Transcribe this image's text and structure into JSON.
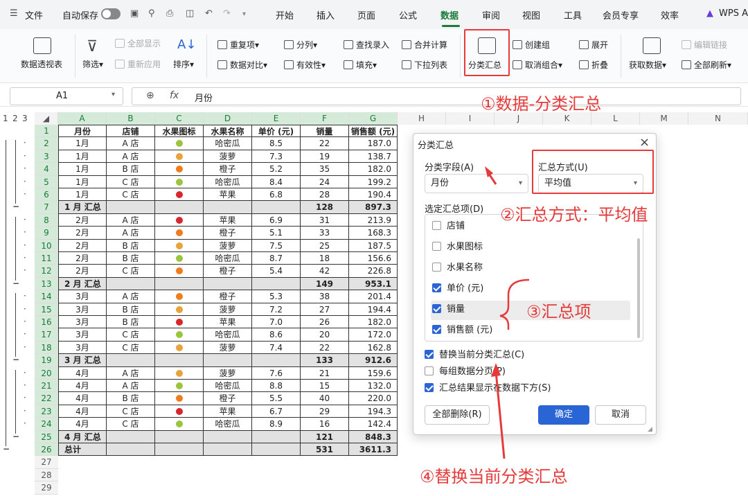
{
  "menubar": {
    "file": "文件",
    "autosave": "自动保存",
    "tabs": [
      "开始",
      "插入",
      "页面",
      "公式",
      "数据",
      "审阅",
      "视图",
      "工具",
      "会员专享",
      "效率"
    ],
    "active": "数据",
    "wps": "WPS A"
  },
  "ribbon": {
    "pivot": "数据透视表",
    "filter": "筛选",
    "show_all": "全部显示",
    "reapply": "重新应用",
    "sort": "排序",
    "duplicates": "重复项",
    "compare": "数据对比",
    "split": "分列",
    "validity": "有效性",
    "lookup": "查找录入",
    "fill": "填充",
    "merge_calc": "合并计算",
    "dropdown": "下拉列表",
    "subtotal": "分类汇总",
    "create_group": "创建组",
    "ungroup": "取消组合",
    "expand": "展开",
    "collapse": "折叠",
    "get_data": "获取数据",
    "edit_links": "编辑链接",
    "refresh_all": "全部刷新"
  },
  "formula_bar": {
    "cell_ref": "A1",
    "fx": "fx",
    "content": "月份"
  },
  "grid": {
    "col_letters": [
      "A",
      "B",
      "C",
      "D",
      "E",
      "F",
      "G",
      "H",
      "I",
      "J",
      "K",
      "L",
      "M",
      "N"
    ],
    "levels": [
      "1",
      "2",
      "3"
    ],
    "headers": [
      "月份",
      "店铺",
      "水果图标",
      "水果名称",
      "单价 (元)",
      "销量",
      "销售额 (元)"
    ],
    "rows": [
      {
        "n": "2",
        "m": "1月",
        "s": "A 店",
        "f": "pear",
        "name": "哈密瓜",
        "p": "8.5",
        "q": "22",
        "a": "187.0"
      },
      {
        "n": "3",
        "m": "1月",
        "s": "A 店",
        "f": "pineapple",
        "name": "菠萝",
        "p": "7.3",
        "q": "19",
        "a": "138.7"
      },
      {
        "n": "4",
        "m": "1月",
        "s": "B 店",
        "f": "orange",
        "name": "橙子",
        "p": "5.2",
        "q": "35",
        "a": "182.0"
      },
      {
        "n": "5",
        "m": "1月",
        "s": "C 店",
        "f": "pear",
        "name": "哈密瓜",
        "p": "8.4",
        "q": "24",
        "a": "199.2"
      },
      {
        "n": "6",
        "m": "1月",
        "s": "C 店",
        "f": "apple",
        "name": "苹果",
        "p": "6.8",
        "q": "28",
        "a": "190.4"
      },
      {
        "n": "7",
        "sub": true,
        "m": "1 月 汇总",
        "q": "128",
        "a": "897.3"
      },
      {
        "n": "8",
        "m": "2月",
        "s": "A 店",
        "f": "apple",
        "name": "苹果",
        "p": "6.9",
        "q": "31",
        "a": "213.9"
      },
      {
        "n": "9",
        "m": "2月",
        "s": "A 店",
        "f": "orange",
        "name": "橙子",
        "p": "5.1",
        "q": "33",
        "a": "168.3"
      },
      {
        "n": "10",
        "m": "2月",
        "s": "B 店",
        "f": "pineapple",
        "name": "菠萝",
        "p": "7.5",
        "q": "25",
        "a": "187.5"
      },
      {
        "n": "11",
        "m": "2月",
        "s": "B 店",
        "f": "pear",
        "name": "哈密瓜",
        "p": "8.7",
        "q": "18",
        "a": "156.6"
      },
      {
        "n": "12",
        "m": "2月",
        "s": "C 店",
        "f": "orange",
        "name": "橙子",
        "p": "5.4",
        "q": "42",
        "a": "226.8"
      },
      {
        "n": "13",
        "sub": true,
        "m": "2 月 汇总",
        "q": "149",
        "a": "953.1"
      },
      {
        "n": "14",
        "m": "3月",
        "s": "A 店",
        "f": "orange",
        "name": "橙子",
        "p": "5.3",
        "q": "38",
        "a": "201.4"
      },
      {
        "n": "15",
        "m": "3月",
        "s": "B 店",
        "f": "pineapple",
        "name": "菠萝",
        "p": "7.2",
        "q": "27",
        "a": "194.4"
      },
      {
        "n": "16",
        "m": "3月",
        "s": "B 店",
        "f": "apple",
        "name": "苹果",
        "p": "7.0",
        "q": "26",
        "a": "182.0"
      },
      {
        "n": "17",
        "m": "3月",
        "s": "C 店",
        "f": "pear",
        "name": "哈密瓜",
        "p": "8.6",
        "q": "20",
        "a": "172.0"
      },
      {
        "n": "18",
        "m": "3月",
        "s": "C 店",
        "f": "pineapple",
        "name": "菠萝",
        "p": "7.4",
        "q": "22",
        "a": "162.8"
      },
      {
        "n": "19",
        "sub": true,
        "m": "3 月 汇总",
        "q": "133",
        "a": "912.6"
      },
      {
        "n": "20",
        "m": "4月",
        "s": "A 店",
        "f": "pineapple",
        "name": "菠萝",
        "p": "7.6",
        "q": "21",
        "a": "159.6"
      },
      {
        "n": "21",
        "m": "4月",
        "s": "A 店",
        "f": "pear",
        "name": "哈密瓜",
        "p": "8.8",
        "q": "15",
        "a": "132.0"
      },
      {
        "n": "22",
        "m": "4月",
        "s": "B 店",
        "f": "orange",
        "name": "橙子",
        "p": "5.5",
        "q": "40",
        "a": "220.0"
      },
      {
        "n": "23",
        "m": "4月",
        "s": "C 店",
        "f": "apple",
        "name": "苹果",
        "p": "6.7",
        "q": "29",
        "a": "194.3"
      },
      {
        "n": "24",
        "m": "4月",
        "s": "C 店",
        "f": "pear",
        "name": "哈密瓜",
        "p": "8.9",
        "q": "16",
        "a": "142.4"
      },
      {
        "n": "25",
        "sub": true,
        "m": "4 月 汇总",
        "q": "121",
        "a": "848.3"
      },
      {
        "n": "26",
        "sub": true,
        "m": "总计",
        "q": "531",
        "a": "3611.3"
      }
    ],
    "empty_rows": [
      "27",
      "28",
      "29"
    ]
  },
  "dialog": {
    "title": "分类汇总",
    "field_label": "分类字段(A)",
    "field_value": "月份",
    "method_label": "汇总方式(U)",
    "method_value": "平均值",
    "items_label": "选定汇总项(D)",
    "items": [
      {
        "label": "店铺",
        "checked": false
      },
      {
        "label": "水果图标",
        "checked": false
      },
      {
        "label": "水果名称",
        "checked": false
      },
      {
        "label": "单价 (元)",
        "checked": true
      },
      {
        "label": "销量",
        "checked": true
      },
      {
        "label": "销售额 (元)",
        "checked": true
      }
    ],
    "opt1": "替换当前分类汇总(C)",
    "opt2": "每组数据分页(P)",
    "opt3": "汇总结果显示在数据下方(S)",
    "remove_all": "全部删除(R)",
    "ok": "确定",
    "cancel": "取消"
  },
  "annotations": {
    "a1": "①数据-分类汇总",
    "a2": "②汇总方式：平均值",
    "a3": "③汇总项",
    "a4": "④替换当前分类汇总"
  },
  "colors": {
    "accent": "#2965d4",
    "green": "#1a7a3a",
    "annot": "#e63a3a"
  }
}
